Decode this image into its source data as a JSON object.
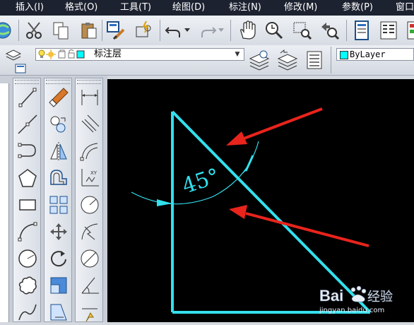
{
  "menubar": {
    "items": [
      "插入(I)",
      "格式(O)",
      "工具(T)",
      "绘图(D)",
      "标注(N)",
      "修改(M)",
      "参数(P)",
      "窗口"
    ]
  },
  "layer_toolbar": {
    "current_layer": "标注层",
    "layer_color": "#00ffff"
  },
  "properties_toolbar": {
    "color_value": "ByLayer",
    "color_swatch": "#00ffff"
  },
  "drawing": {
    "angle_label": "45°",
    "line_color": "#33e0ee",
    "arrow_color": "#e8241c"
  },
  "watermark": {
    "brand": "Bai",
    "brand_suffix": "经验",
    "url": "jingyan.baidu.com"
  },
  "colors": {
    "menubar_bg": "#1c2230",
    "canvas_bg": "#000000",
    "toolbar_bg": "#dde1e8"
  }
}
